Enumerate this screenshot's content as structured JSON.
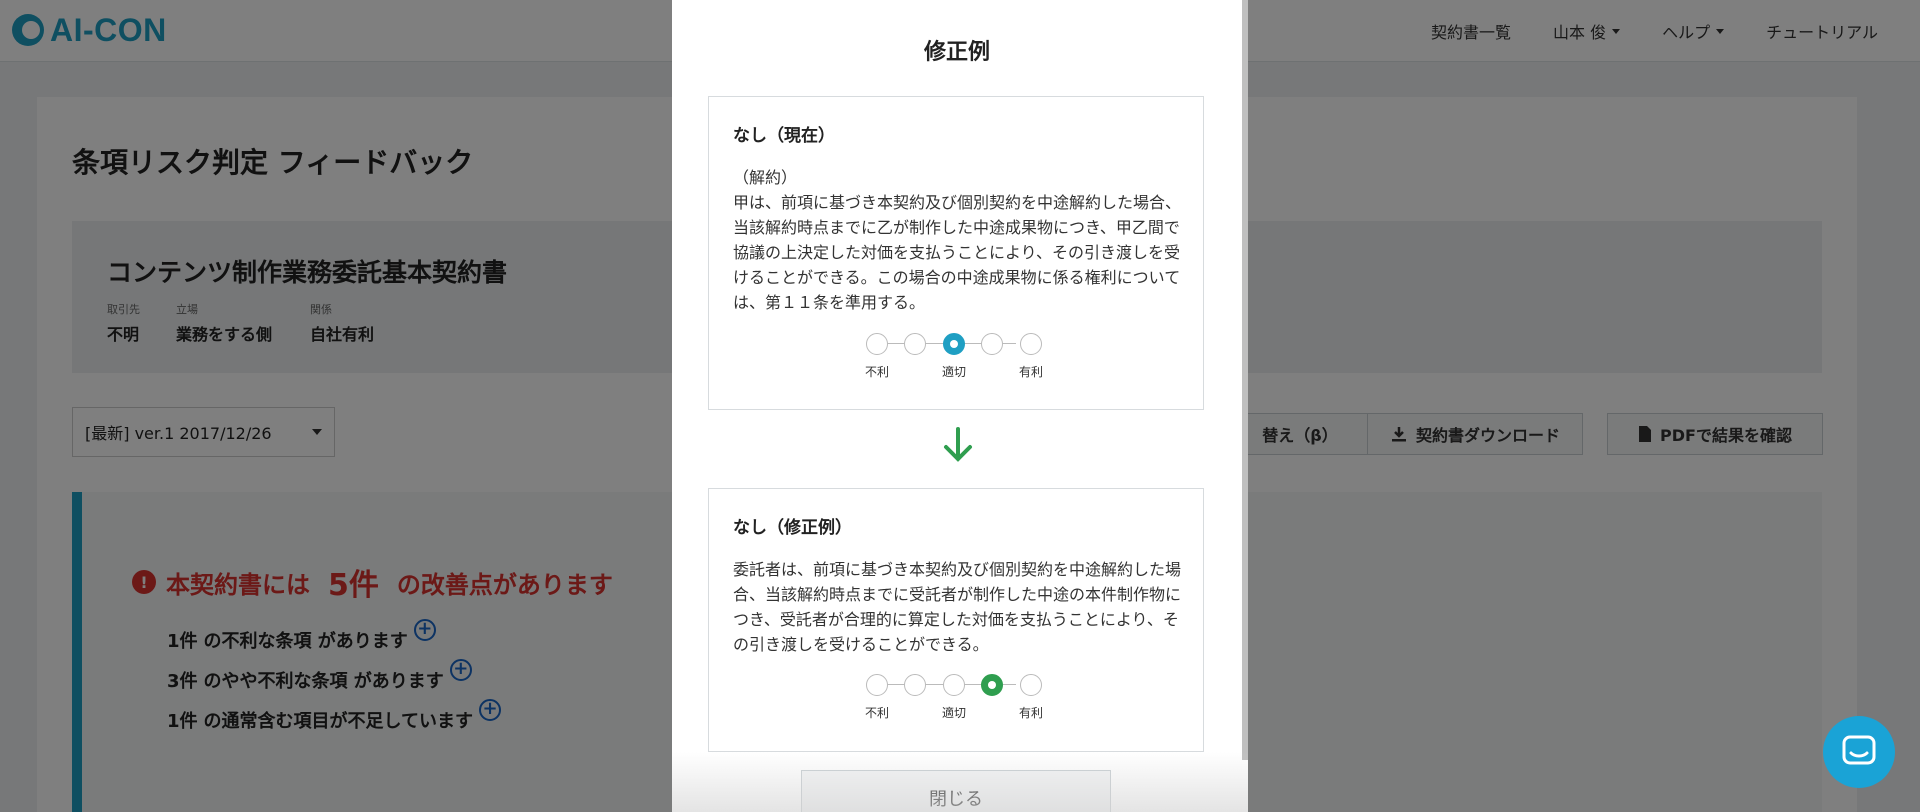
{
  "header": {
    "logo_text": "AI-CON",
    "nav": [
      "契約書一覧",
      "山本 俊",
      "ヘルプ",
      "チュートリアル"
    ]
  },
  "page": {
    "title": "条項リスク判定 フィードバック",
    "contract": {
      "title": "コンテンツ制作業務委託基本契約書",
      "meta": [
        {
          "label": "取引先",
          "value": "不明"
        },
        {
          "label": "立場",
          "value": "業務をする側"
        },
        {
          "label": "関係",
          "value": "自社有利"
        }
      ]
    },
    "version_select": "[最新] ver.1 2017/12/26",
    "actions": [
      "替え（β）",
      "契約書ダウンロード",
      "PDFで結果を確認"
    ],
    "issues": {
      "head_pre": "本契約書には",
      "head_count": "5件",
      "head_post": "の改善点があります",
      "lines": [
        {
          "count": "1件",
          "text": "の不利な条項 があります"
        },
        {
          "count": "3件",
          "text": "のやや不利な条項 があります"
        },
        {
          "count": "1件",
          "text": "の通常含む項目が不足しています"
        }
      ]
    }
  },
  "modal": {
    "title": "修正例",
    "current": {
      "heading": "なし（現在）",
      "body": "（解約）\n甲は、前項に基づき本契約及び個別契約を中途解約した場合、当該解約時点までに乙が制作した中途成果物につき、甲乙間で協議の上決定した対価を支払うことにより、その引き渡しを受けることができる。この場合の中途成果物に係る権利については、第１１条を準用する。",
      "scale_selected": 3
    },
    "revised": {
      "heading": "なし（修正例）",
      "body": "委託者は、前項に基づき本契約及び個別契約を中途解約した場合、当該解約時点までに受託者が制作した中途の本件制作物につき、受託者が合理的に算定した対価を支払うことにより、その引き渡しを受けることができる。",
      "scale_selected": 4
    },
    "scale_labels": [
      "不利",
      "適切",
      "有利"
    ],
    "close_label": "閉じる"
  },
  "colors": {
    "accent": "#1f9fc3",
    "warning": "#d9322f",
    "success": "#2f9e4f",
    "link": "#1a66c7"
  }
}
